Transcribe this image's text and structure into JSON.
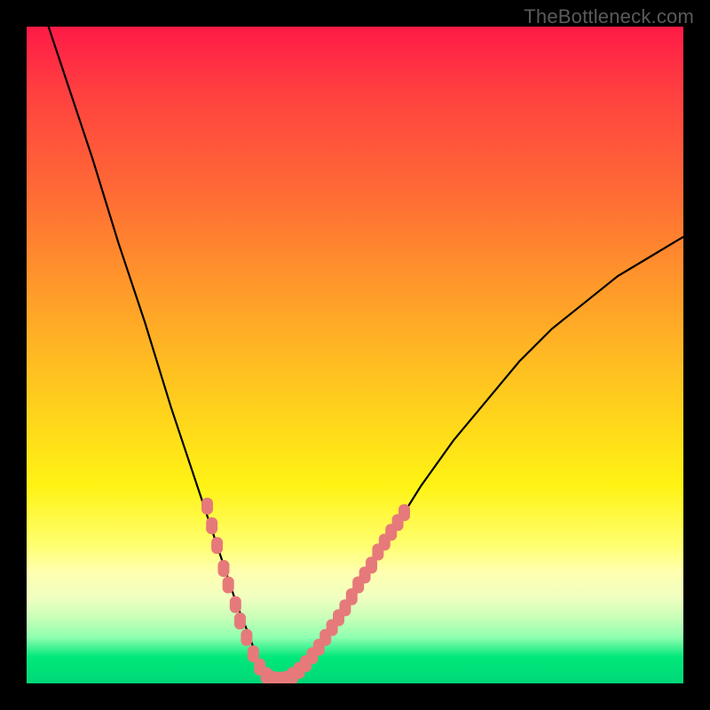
{
  "attribution": "TheBottleneck.com",
  "colors": {
    "frame": "#000000",
    "curve": "#000000",
    "marker": "#e67a7a",
    "gradient_top": "#ff1a47",
    "gradient_bottom": "#00d878"
  },
  "chart_data": {
    "type": "line",
    "title": "",
    "xlabel": "",
    "ylabel": "",
    "xlim": [
      0,
      100
    ],
    "ylim": [
      0,
      100
    ],
    "series": [
      {
        "name": "bottleneck-curve",
        "x": [
          0,
          5,
          10,
          14,
          18,
          22,
          25,
          28,
          30,
          32,
          34,
          35,
          36,
          37,
          38,
          39,
          40,
          42,
          44,
          47,
          50,
          55,
          60,
          65,
          70,
          75,
          80,
          85,
          90,
          95,
          100
        ],
        "values": [
          110,
          95,
          80,
          67,
          55,
          42,
          33,
          24,
          18,
          12,
          7,
          4,
          2,
          1,
          0.5,
          0.5,
          1,
          2.5,
          5,
          9,
          14,
          22,
          30,
          37,
          43,
          49,
          54,
          58,
          62,
          65,
          68
        ]
      }
    ],
    "markers": [
      {
        "x": 27.5,
        "y": 27
      },
      {
        "x": 28.2,
        "y": 24
      },
      {
        "x": 29.0,
        "y": 21
      },
      {
        "x": 30.0,
        "y": 17.5
      },
      {
        "x": 30.7,
        "y": 15
      },
      {
        "x": 31.8,
        "y": 12
      },
      {
        "x": 32.5,
        "y": 9.5
      },
      {
        "x": 33.5,
        "y": 7
      },
      {
        "x": 34.5,
        "y": 4.5
      },
      {
        "x": 35.5,
        "y": 2.5
      },
      {
        "x": 36.5,
        "y": 1.2
      },
      {
        "x": 37.5,
        "y": 0.6
      },
      {
        "x": 38.5,
        "y": 0.5
      },
      {
        "x": 39.5,
        "y": 0.6
      },
      {
        "x": 40.5,
        "y": 1.2
      },
      {
        "x": 41.5,
        "y": 2.0
      },
      {
        "x": 42.5,
        "y": 3.0
      },
      {
        "x": 43.5,
        "y": 4.2
      },
      {
        "x": 44.5,
        "y": 5.5
      },
      {
        "x": 45.5,
        "y": 7.0
      },
      {
        "x": 46.5,
        "y": 8.5
      },
      {
        "x": 47.5,
        "y": 10.0
      },
      {
        "x": 48.5,
        "y": 11.5
      },
      {
        "x": 49.5,
        "y": 13.2
      },
      {
        "x": 50.5,
        "y": 15.0
      },
      {
        "x": 51.5,
        "y": 16.5
      },
      {
        "x": 52.5,
        "y": 18.0
      },
      {
        "x": 53.5,
        "y": 20.0
      },
      {
        "x": 54.5,
        "y": 21.5
      },
      {
        "x": 55.5,
        "y": 23.0
      },
      {
        "x": 56.5,
        "y": 24.5
      },
      {
        "x": 57.5,
        "y": 26.0
      }
    ]
  }
}
